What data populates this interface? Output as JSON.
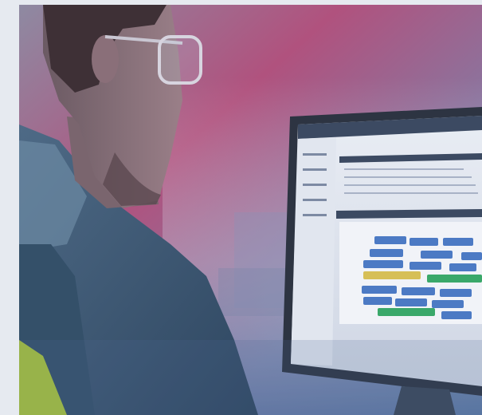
{
  "image": {
    "subject": "man-with-glasses-viewing-scheduling-software",
    "colors": {
      "page_bg": "#e6eaf0",
      "magenta_tint": "#b0527e",
      "blue_tint": "#4f6c94",
      "jacket": "#3d5670",
      "hivis": "#a9c43a"
    }
  }
}
